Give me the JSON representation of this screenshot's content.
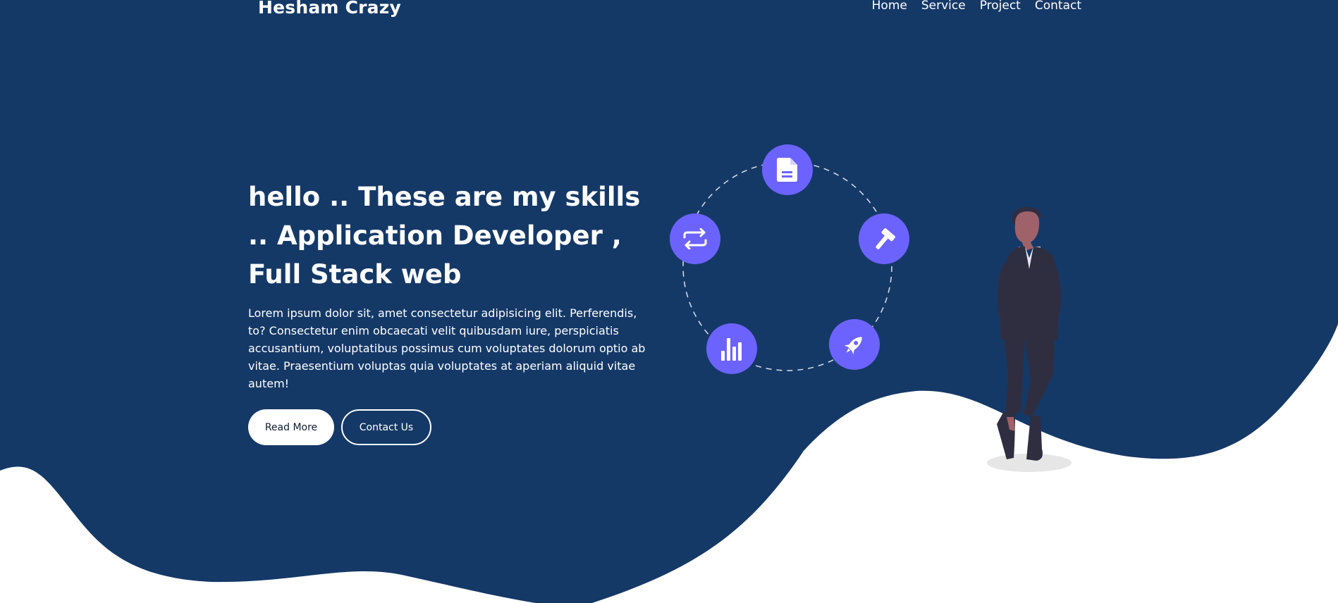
{
  "brand": "Hesham Crazy",
  "nav": {
    "home": "Home",
    "service": "Service",
    "project": "Project",
    "contact": "Contact"
  },
  "hero": {
    "title": "hello .. These are my skills .. Application Developer , Full Stack web",
    "text": "Lorem ipsum dolor sit, amet consectetur adipisicing elit. Perferendis, to? Consectetur enim obcaecati velit quibusdam iure, perspiciatis accusantium, voluptatibus possimus cum voluptates dolorum optio ab vitae. Praesentium voluptas quia voluptates at aperiam aliquid vitae autem!",
    "read_more": "Read More",
    "contact_us": "Contact Us"
  },
  "skills": [
    "document-icon",
    "hammer-icon",
    "rocket-icon",
    "bar-chart-icon",
    "repeat-icon"
  ],
  "colors": {
    "background": "#153967",
    "accent": "#6c63ff",
    "white": "#ffffff",
    "suit": "#2f2e41"
  }
}
